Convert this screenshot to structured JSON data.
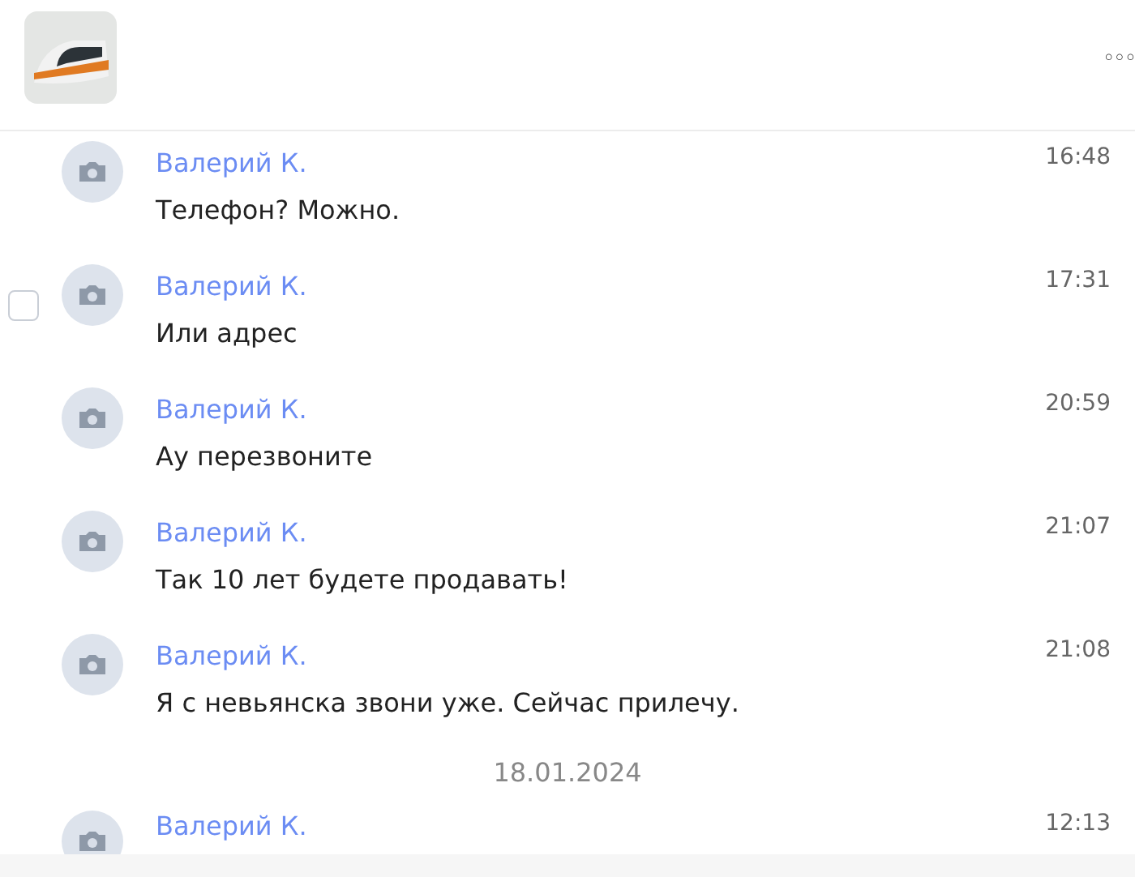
{
  "header": {
    "menu": "◦◦◦"
  },
  "messages": [
    {
      "author": "Валерий К.",
      "time": "16:48",
      "text": "Телефон? Можно."
    },
    {
      "author": "Валерий К.",
      "time": "17:31",
      "text": "Или адрес",
      "checkbox": {
        "checked": false
      }
    },
    {
      "author": "Валерий К.",
      "time": "20:59",
      "text": "Ау перезвоните"
    },
    {
      "author": "Валерий К.",
      "time": "21:07",
      "text": "Так 10 лет будете продавать!"
    },
    {
      "author": "Валерий К.",
      "time": "21:08",
      "text": "Я с невьянска звони уже. Сейчас прилечу."
    }
  ],
  "date_separator": "18.01.2024",
  "partial_message": {
    "author": "Валерий К.",
    "time": "12:13"
  }
}
